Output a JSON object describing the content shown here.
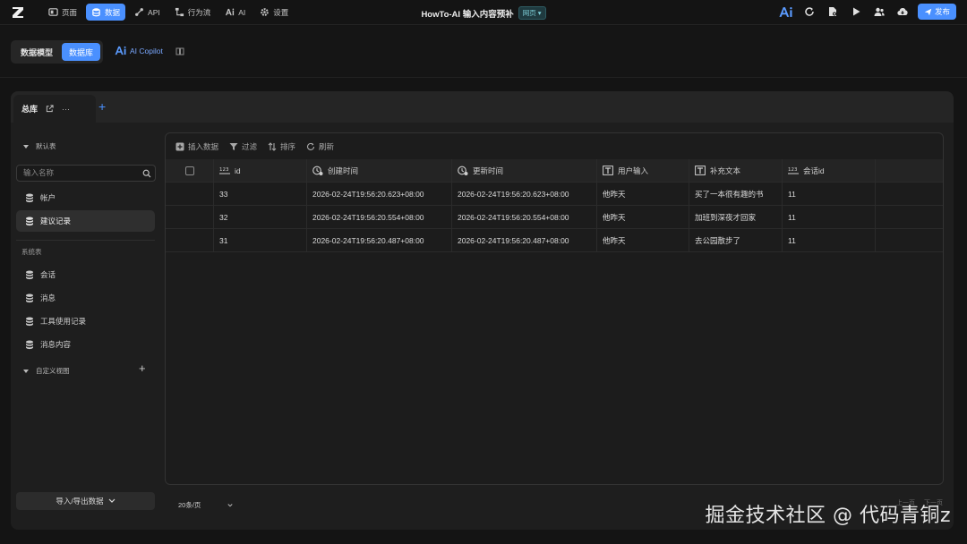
{
  "topbar": {
    "nav": [
      {
        "label": "页面",
        "icon": "page-icon"
      },
      {
        "label": "数据",
        "icon": "database-icon",
        "active": true
      },
      {
        "label": "API",
        "icon": "api-icon"
      },
      {
        "label": "行为流",
        "icon": "flow-icon"
      },
      {
        "label": "AI",
        "icon": "ai-icon"
      },
      {
        "label": "设置",
        "icon": "gear-icon"
      }
    ],
    "title": "HowTo-AI 输入内容预补",
    "badge": "网页",
    "publish_label": "发布",
    "accent": "#4a90ff"
  },
  "subbar": {
    "segments": [
      "数据模型",
      "数据库"
    ],
    "active_segment": 1,
    "copilot_label": "AI Copilot"
  },
  "tab": {
    "label": "总库",
    "more": "···"
  },
  "sidebar": {
    "default_section": "默认表",
    "search_placeholder": "输入名称",
    "default_items": [
      "帐户",
      "建议记录"
    ],
    "active_item": "建议记录",
    "system_section": "系统表",
    "system_items": [
      "会话",
      "消息",
      "工具使用记录",
      "消息内容"
    ],
    "custom_section": "自定义视图",
    "import_label": "导入/导出数据"
  },
  "toolbar": {
    "insert": "插入数据",
    "filter": "过滤",
    "sort": "排序",
    "refresh": "刷新"
  },
  "table": {
    "columns": [
      {
        "label": "id",
        "icon": "number-icon"
      },
      {
        "label": "创建时间",
        "icon": "clock-icon"
      },
      {
        "label": "更新时间",
        "icon": "clock-icon"
      },
      {
        "label": "用户输入",
        "icon": "text-icon"
      },
      {
        "label": "补充文本",
        "icon": "text-icon"
      },
      {
        "label": "会话id",
        "icon": "number-icon"
      }
    ],
    "rows": [
      [
        "33",
        "2026-02-24T19:56:20.623+08:00",
        "2026-02-24T19:56:20.623+08:00",
        "他昨天",
        "买了一本很有趣的书",
        "11"
      ],
      [
        "32",
        "2026-02-24T19:56:20.554+08:00",
        "2026-02-24T19:56:20.554+08:00",
        "他昨天",
        "加班到深夜才回家",
        "11"
      ],
      [
        "31",
        "2026-02-24T19:56:20.487+08:00",
        "2026-02-24T19:56:20.487+08:00",
        "他昨天",
        "去公园散步了",
        "11"
      ]
    ]
  },
  "pagination": {
    "page_size": "20条/页",
    "prev": "上一页",
    "next": "下一页"
  },
  "watermark": "掘金技术社区 @ 代码青铜z"
}
